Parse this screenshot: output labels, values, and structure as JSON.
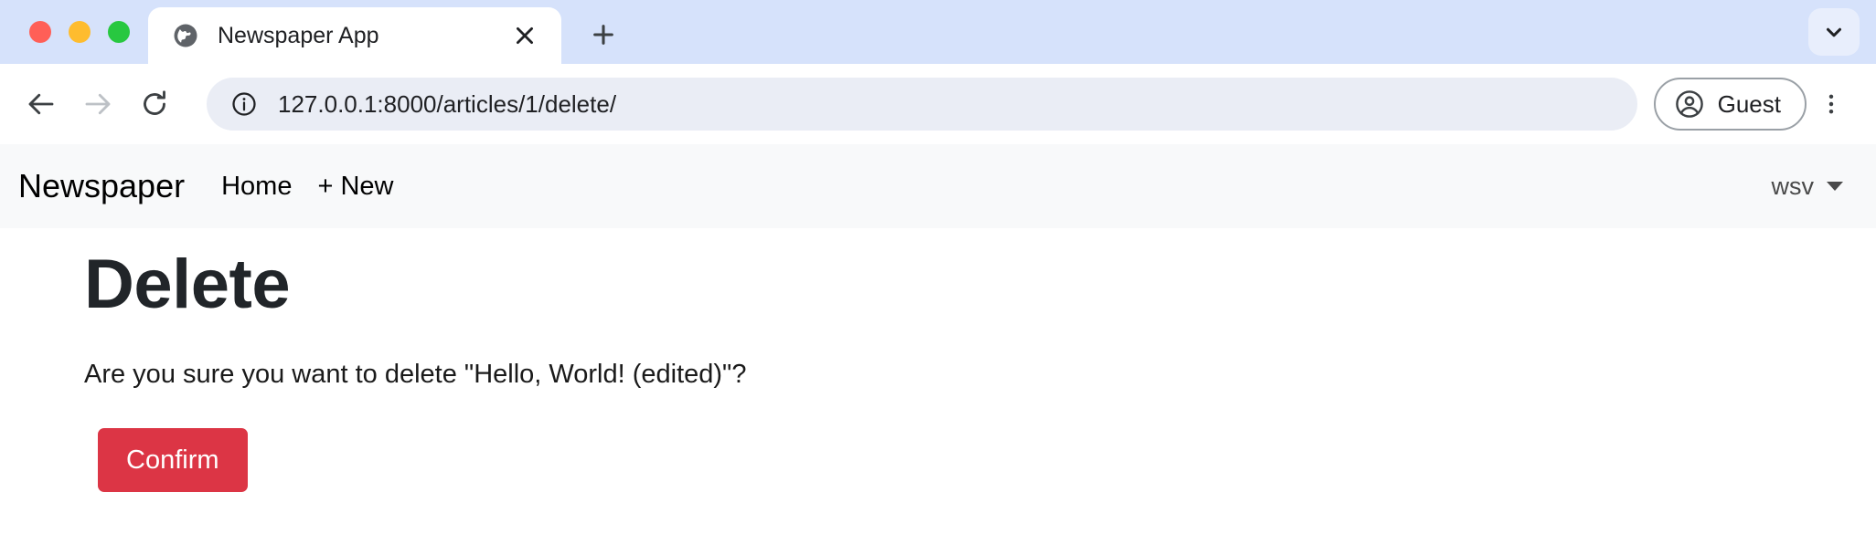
{
  "browser": {
    "window_controls": [
      {
        "name": "close",
        "color": "#ff5f57"
      },
      {
        "name": "minimize",
        "color": "#febc2e"
      },
      {
        "name": "maximize",
        "color": "#28c840"
      }
    ],
    "tab": {
      "title": "Newspaper App",
      "favicon": "globe-icon",
      "close_icon": "close-icon"
    },
    "new_tab_icon": "plus-icon",
    "tab_list_icon": "chevron-down-icon",
    "toolbar": {
      "back_icon": "arrow-left-icon",
      "forward_icon": "arrow-right-icon",
      "reload_icon": "reload-icon",
      "site_info_icon": "info-circle-icon",
      "url": "127.0.0.1:8000/articles/1/delete/",
      "profile_icon": "account-circle-icon",
      "profile_label": "Guest",
      "menu_icon": "three-dots-vertical-icon"
    }
  },
  "site": {
    "navbar": {
      "brand": "Newspaper",
      "links": [
        {
          "label": "Home"
        },
        {
          "label": "+ New"
        }
      ],
      "user": "wsv",
      "user_caret_icon": "caret-down-icon"
    },
    "main": {
      "heading": "Delete",
      "message": "Are you sure you want to delete \"Hello, World! (edited)\"?",
      "confirm_button": "Confirm",
      "confirm_button_color": "#dc3545"
    }
  }
}
